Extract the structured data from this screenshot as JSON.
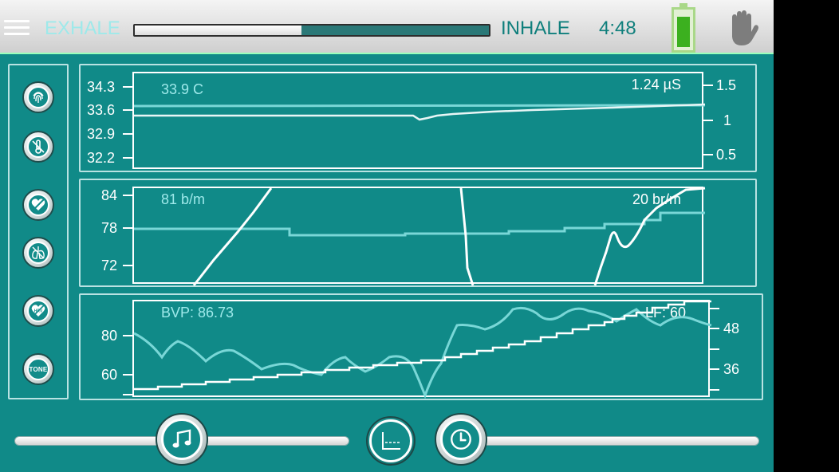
{
  "header": {
    "exhale_label": "EXHALE",
    "inhale_label": "INHALE",
    "timer": "4:48",
    "breath_progress": 0.47,
    "battery_level": 0.75,
    "icons": [
      "menu-icon",
      "battery-icon",
      "hand-stop-icon"
    ]
  },
  "sidebar": {
    "buttons": [
      {
        "icon": "fingerprint-icon"
      },
      {
        "icon": "thermometer-off-icon"
      },
      {
        "icon": "heart-off-icon"
      },
      {
        "icon": "lungs-off-icon"
      },
      {
        "icon": "hrv-heart-off-icon",
        "badge": "HRV"
      },
      {
        "icon": "tone-icon",
        "label": "TONE"
      }
    ]
  },
  "panels": {
    "skin": {
      "value_left": "33.9 C",
      "value_right": "1.24 µS",
      "left_ticks": [
        "34.3",
        "33.6",
        "32.9",
        "32.2"
      ],
      "right_ticks": [
        "1.5",
        "1",
        "0.5"
      ]
    },
    "heart": {
      "value_left": "81 b/m",
      "value_right": "20 br/m",
      "left_ticks": [
        "84",
        "78",
        "72"
      ]
    },
    "bvp": {
      "value_left": "BVP: 86.73",
      "value_right": "LF: 60",
      "left_ticks": [
        "80",
        "60"
      ],
      "right_ticks": [
        "48",
        "36"
      ]
    }
  },
  "controls": {
    "music_icon": "music-note-icon",
    "baseline_icon": "baseline-chart-icon",
    "clock_icon": "clock-icon",
    "music_slider_value": 0.5,
    "time_slider_value": 0.0
  },
  "colors": {
    "background": "#108a88",
    "accent": "#9ee9ea",
    "battery": "#3cb01f"
  }
}
